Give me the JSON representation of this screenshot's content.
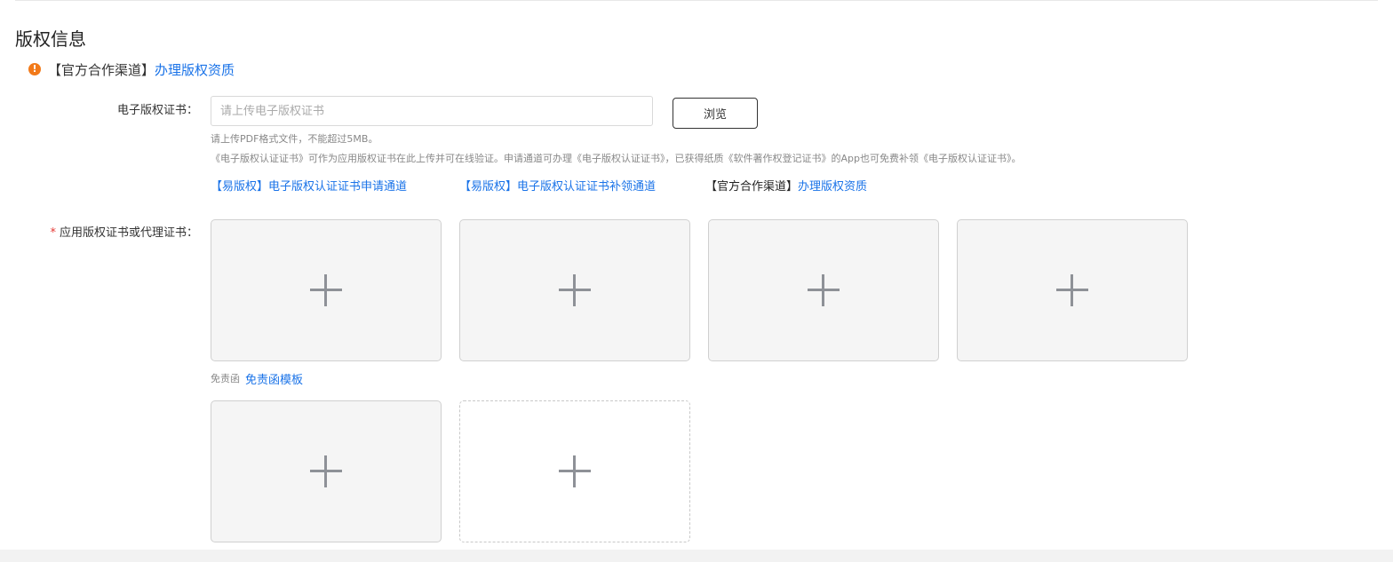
{
  "section": {
    "title": "版权信息"
  },
  "notice": {
    "icon": "warning-icon",
    "icon_glyph": "!",
    "prefix": "【官方合作渠道】",
    "link": "办理版权资质"
  },
  "ecert": {
    "label": "电子版权证书：",
    "placeholder": "请上传电子版权证书",
    "value": "",
    "browse_label": "浏览",
    "hint_format": "请上传PDF格式文件，不能超过5MB。",
    "hint_desc": "《电子版权认证证书》可作为应用版权证书在此上传并可在线验证。申请通道可办理《电子版权认证证书》，已获得纸质《软件著作权登记证书》的App也可免费补领《电子版权认证证书》。",
    "links": {
      "apply": "【易版权】电子版权认证证书申请通道",
      "reissue": "【易版权】电子版权认证证书补领通道",
      "official_prefix": "【官方合作渠道】",
      "official_link": "办理版权资质"
    }
  },
  "app_cert": {
    "required_mark": "*",
    "label": "应用版权证书或代理证书：",
    "upload_icon": "plus-icon",
    "upload_count": 6,
    "disclaimer_label": "免责函",
    "disclaimer_link": "免责函模板"
  },
  "colors": {
    "link": "#1a73e8",
    "warning": "#f27a1a",
    "required": "#e53935"
  }
}
